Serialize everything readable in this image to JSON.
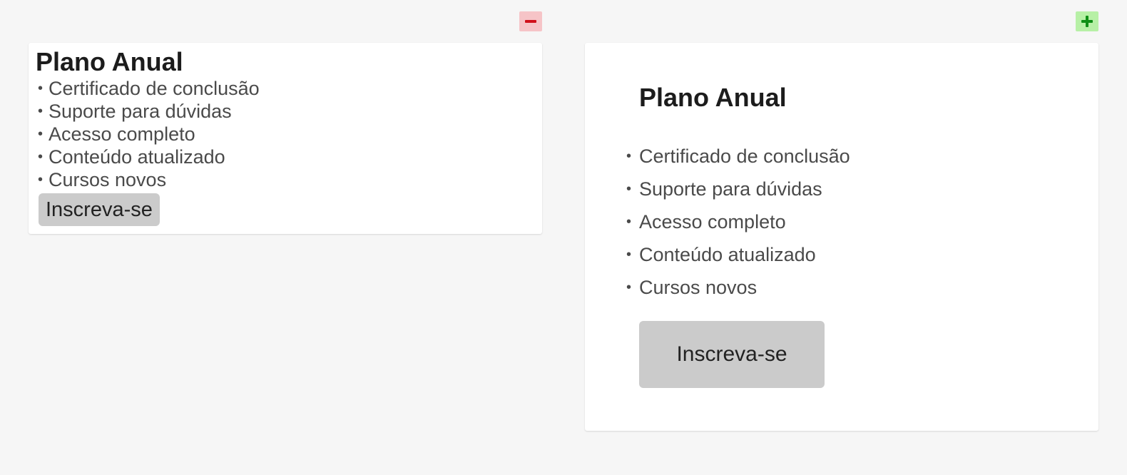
{
  "left_panel": {
    "toggle_icon": "minus-icon",
    "toggle_color": "#d0101a",
    "title": "Plano Anual",
    "features": [
      "Certificado de conclusão",
      "Suporte para dúvidas",
      "Acesso completo",
      "Conteúdo atualizado",
      "Cursos novos"
    ],
    "button_label": "Inscreva-se"
  },
  "right_panel": {
    "toggle_icon": "plus-icon",
    "toggle_color": "#0f8f15",
    "title": "Plano Anual",
    "features": [
      "Certificado de conclusão",
      "Suporte para dúvidas",
      "Acesso completo",
      "Conteúdo atualizado",
      "Cursos novos"
    ],
    "button_label": "Inscreva-se"
  },
  "bullet": "•"
}
